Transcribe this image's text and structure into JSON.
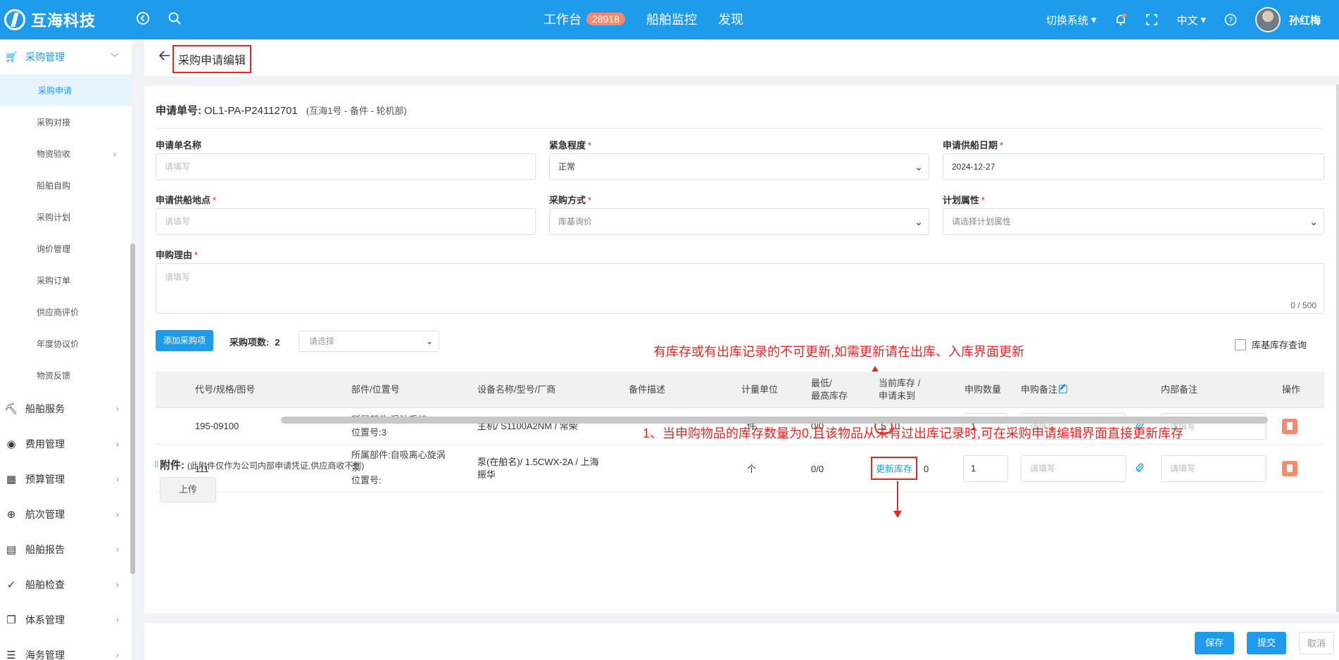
{
  "topbar": {
    "brand": "互海科技",
    "nav": [
      {
        "label": "工作台",
        "badge": "28918"
      },
      {
        "label": "船舶监控"
      },
      {
        "label": "发现"
      }
    ],
    "switch_system": "切换系统",
    "language": "中文",
    "user_name": "孙红梅"
  },
  "sidebar": {
    "group_open": "采购管理",
    "sub_items": [
      "采购申请",
      "采购对接",
      "物资验收",
      "船舶自购",
      "采购计划",
      "询价管理",
      "采购订单",
      "供应商评价",
      "年度协议价",
      "物资反馈"
    ],
    "groups": [
      "船舶服务",
      "费用管理",
      "预算管理",
      "航次管理",
      "船舶报告",
      "船舶检查",
      "体系管理",
      "海务管理"
    ]
  },
  "page": {
    "title": "采购申请编辑"
  },
  "form": {
    "no_label": "申请单号:",
    "no_value": "OL1-PA-P24112701",
    "no_sub": "(互海1号 - 备件 - 轮机部)",
    "name_label": "申请单名称",
    "name_placeholder": "请填写",
    "urgency_label": "紧急程度",
    "urgency_value": "正常",
    "date_label": "申请供船日期",
    "date_value": "2024-12-27",
    "place_label": "申请供船地点",
    "place_placeholder": "请填写",
    "method_label": "采购方式",
    "method_value": "库基询价",
    "plan_label": "计划属性",
    "plan_placeholder": "请选择计划属性",
    "reason_label": "申购理由",
    "reason_placeholder": "请填写",
    "reason_count": "0 / 500",
    "required_mark": "*"
  },
  "items": {
    "add_button": "添加采购项",
    "count_label": "采购项数:",
    "count_value": "2",
    "select_placeholder": "请选择",
    "stock_query_label": "库基库存查询",
    "columns": [
      "代号/规格/图号",
      "部件/位置号",
      "设备名称/型号/厂商",
      "备件描述",
      "计量单位",
      "最低/",
      "最高库存",
      "当前库存 /",
      "申请未到",
      "申购数量",
      "申购备注",
      "内部备注",
      "操作"
    ],
    "rows": [
      {
        "code": "195-09100",
        "part1": "所属部件:滑油系统",
        "part2": "位置号:3",
        "part3": "",
        "equip1": "主机/ S1100A2NM / 常柴",
        "equip2": "",
        "unit": "件",
        "minmax": "0/0",
        "stock": "5",
        "pending": "0",
        "qty": "1",
        "note_placeholder": "请填写",
        "inner_placeholder": "请填写"
      },
      {
        "code": "111",
        "part1": "所属部件:自吸离心旋涡",
        "part2": "泵",
        "part3": "位置号:",
        "equip1": "泵(在舶名)/ 1.5CWX-2A / 上海",
        "equip2": "振华",
        "unit": "个",
        "minmax": "0/0",
        "stock_action": "更新库存",
        "pending": "0",
        "qty": "1",
        "note_placeholder": "请填写",
        "inner_placeholder": "请填写"
      }
    ]
  },
  "annotations": {
    "top": "有库存或有出库记录的不可更新,如需更新请在出库、入库界面更新",
    "bottom": "1、当申购物品的库存数量为0,且该物品从未有过出库记录时,可在采购申请编辑界面直接更新库存"
  },
  "attachment": {
    "label": "附件:",
    "note": "(此附件仅作为公司内部申请凭证,供应商收不到)",
    "upload": "上传"
  },
  "footer": {
    "save": "保存",
    "submit": "提交",
    "cancel": "取消"
  },
  "colors": {
    "primary": "#1e9bea",
    "danger": "#e82525",
    "badge": "#f7896d"
  }
}
